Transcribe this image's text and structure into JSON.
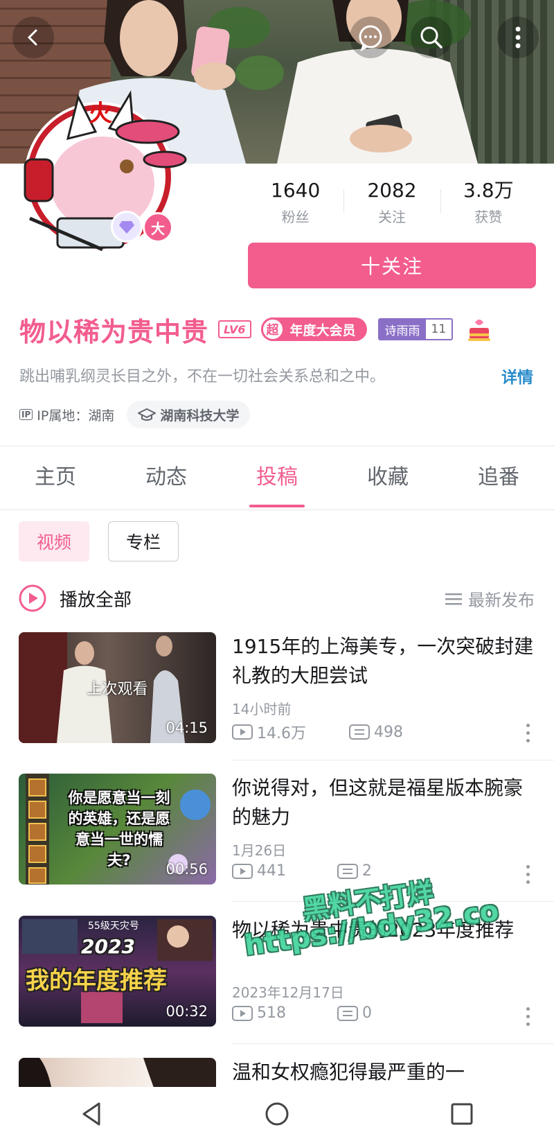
{
  "header": {
    "back_icon": "chevron-left-icon",
    "actions": [
      "chat-icon",
      "search-icon",
      "more-vertical-icon"
    ]
  },
  "profile": {
    "stats": [
      {
        "value": "1640",
        "label": "粉丝"
      },
      {
        "value": "2082",
        "label": "关注"
      },
      {
        "value": "3.8万",
        "label": "获赞"
      }
    ],
    "follow_label": "十关注",
    "avatar_badge": "大",
    "name": "物以稀为贵中贵",
    "level": "LV6",
    "vip_prefix": "超",
    "vip_label": "年度大会员",
    "medal_name": "诗雨雨",
    "medal_level": "11",
    "bio": "跳出哺乳纲灵长目之外，不在一切社会关系总和之中。",
    "detail_link": "详情",
    "ip_badge": "IP",
    "ip_location": "IP属地：湖南",
    "school": "湖南科技大学"
  },
  "tabs": [
    {
      "label": "主页",
      "active": false
    },
    {
      "label": "动态",
      "active": false
    },
    {
      "label": "投稿",
      "active": true
    },
    {
      "label": "收藏",
      "active": false
    },
    {
      "label": "追番",
      "active": false
    }
  ],
  "sub_tabs": {
    "video": "视频",
    "column": "专栏"
  },
  "list_header": {
    "play_all": "播放全部",
    "sort": "最新发布"
  },
  "videos": [
    {
      "title": "1915年的上海美专，一次突破封建礼教的大胆尝试",
      "date": "14小时前",
      "plays": "14.6万",
      "comments": "498",
      "duration": "04:15",
      "overlay": "上次观看"
    },
    {
      "title": "你说得对，但这就是福星版本腕豪的魅力",
      "date": "1月26日",
      "plays": "441",
      "comments": "2",
      "duration": "00:56",
      "overlay": "你是愿意当一刻的英雄，还是愿意当一世的懦夫?"
    },
    {
      "title": "物以稀为贵中贵的2023年度推荐",
      "date": "2023年12月17日",
      "plays": "518",
      "comments": "0",
      "duration": "00:32",
      "overlay_top": "2023",
      "overlay": "我的年度推荐",
      "overlay_small": "55级天灾号"
    },
    {
      "title": "温和女权瘾犯得最严重的一",
      "date": "",
      "plays": "",
      "comments": "",
      "duration": ""
    }
  ],
  "watermark": {
    "line1": "黑料不打烊",
    "line2": "https://bdy32.co"
  },
  "colors": {
    "accent": "#f25d8e",
    "link": "#2a8ccb",
    "muted": "#9499a0"
  }
}
